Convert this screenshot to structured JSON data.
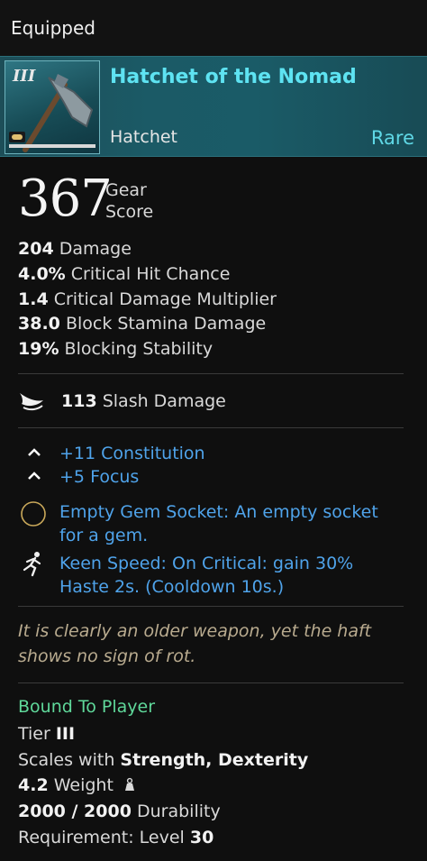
{
  "header": {
    "title": "Equipped"
  },
  "item": {
    "tier_numeral": "III",
    "name": "Hatchet of the Nomad",
    "type": "Hatchet",
    "rarity": "Rare"
  },
  "gear_score": {
    "value": "367",
    "label": "Gear Score"
  },
  "base_stats": [
    {
      "value": "204",
      "label": "Damage"
    },
    {
      "value": "4.0%",
      "label": "Critical Hit Chance"
    },
    {
      "value": "1.4",
      "label": "Critical Damage Multiplier"
    },
    {
      "value": "38.0",
      "label": "Block Stamina Damage"
    },
    {
      "value": "19%",
      "label": "Blocking Stability"
    }
  ],
  "damage_type": {
    "value": "113",
    "label": "Slash Damage",
    "icon": "slash-icon"
  },
  "attributes": [
    {
      "value": "+11",
      "label": "Constitution",
      "icon": "chevron-up-icon"
    },
    {
      "value": "+5",
      "label": "Focus",
      "icon": "chevron-up-icon"
    }
  ],
  "perks": [
    {
      "name": "Empty Gem Socket:",
      "desc_line1": "An empty socket",
      "desc_line2": "for a gem.",
      "icon": "gem-socket-icon"
    },
    {
      "name": "Keen Speed:",
      "desc_line1": "On Critical: gain 30%",
      "desc_line2": "Haste 2s. (Cooldown 10s.)",
      "icon": "running-icon"
    }
  ],
  "flavor_text": {
    "line1": "It is clearly an older weapon, yet the haft",
    "line2": "shows no sign of rot."
  },
  "footer": {
    "bound": "Bound To Player",
    "tier_label": "Tier",
    "tier_value": "III",
    "scales_label": "Scales with",
    "scales_value": "Strength, Dexterity",
    "weight_value": "4.2",
    "weight_label": "Weight",
    "durability_value": "2000 / 2000",
    "durability_label": "Durability",
    "requirement_label": "Requirement:  Level",
    "requirement_value": "30"
  },
  "colors": {
    "rarity": "#5fd8e6",
    "perk_blue": "#4fa3ea",
    "bound_green": "#5fd89a",
    "flavor": "#b9ab8f"
  }
}
